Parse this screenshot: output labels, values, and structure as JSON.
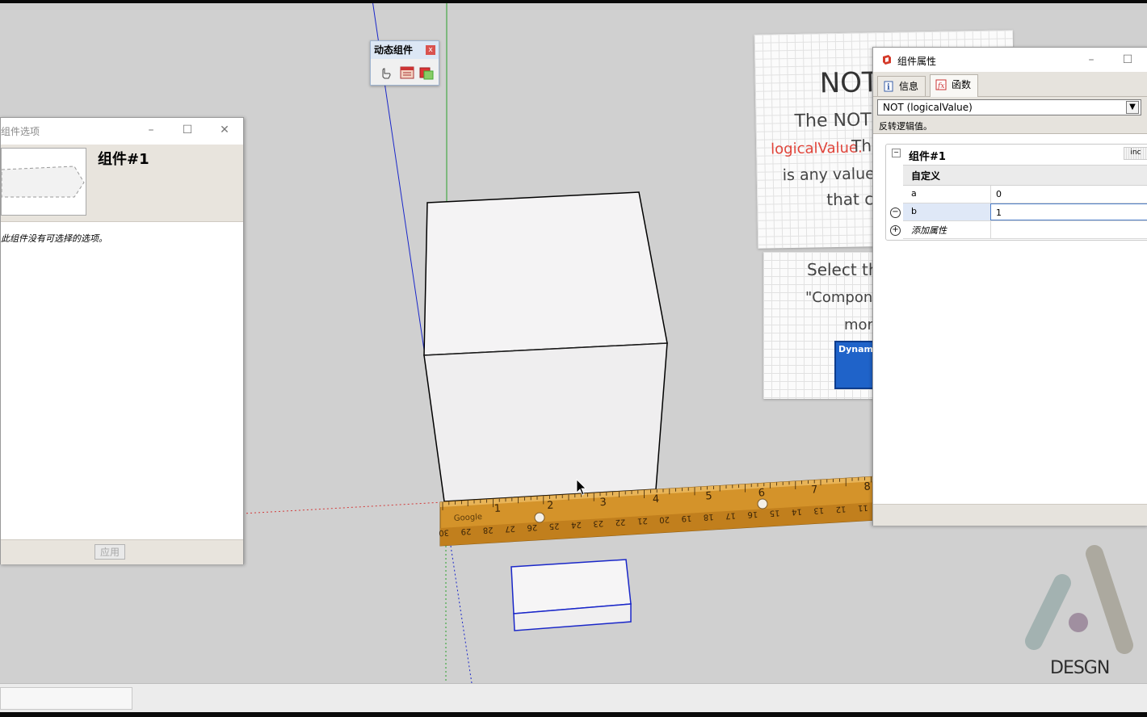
{
  "dynamic_toolbar": {
    "title": "动态组件",
    "close_label": "x",
    "buttons": [
      "interact-icon",
      "component-options-icon",
      "component-attributes-icon"
    ]
  },
  "options_dialog": {
    "title": "组件选项",
    "component_name": "组件#1",
    "message": "此组件没有可选择的选项。",
    "apply_label": "应用"
  },
  "attributes_dialog": {
    "title": "组件属性",
    "tabs": [
      {
        "label": "信息",
        "icon": "info-icon"
      },
      {
        "label": "函数",
        "icon": "function-icon",
        "active": true
      }
    ],
    "function_select": "NOT (logicalValue)",
    "function_desc": "反转逻辑值。",
    "panel_title": "组件#1",
    "panel_toggle": "inc",
    "section": "自定义",
    "attributes": [
      {
        "name": "a",
        "value": "0"
      },
      {
        "name": "b",
        "value": "1",
        "editing": true
      }
    ],
    "add_attribute_label": "添加属性"
  },
  "tutorial_note_1": {
    "lines": [
      "NOT(",
      "The NOT fun",
      "logicalValue.",
      "The",
      "is any value th",
      "that ca"
    ]
  },
  "tutorial_note_2": {
    "lines": [
      "Select the",
      "\"Component",
      "more"
    ],
    "button_label": "Dynam"
  },
  "ruler": {
    "brand": "Google",
    "inch_marks": [
      "1",
      "2",
      "3",
      "4",
      "5",
      "6",
      "7",
      "8"
    ],
    "cm_marks": [
      "30",
      "29",
      "28",
      "27",
      "26",
      "25",
      "24",
      "23",
      "22",
      "21",
      "20",
      "19",
      "18",
      "17",
      "16",
      "15",
      "14",
      "13",
      "12",
      "11"
    ]
  },
  "logo": {
    "text": "DESGN"
  },
  "colors": {
    "axis_blue": "#1a27c9",
    "axis_green": "#2aa12a",
    "axis_red": "#d23a3a",
    "ruler_wood": "#d4932a",
    "selection_blue": "#1a27c9"
  }
}
